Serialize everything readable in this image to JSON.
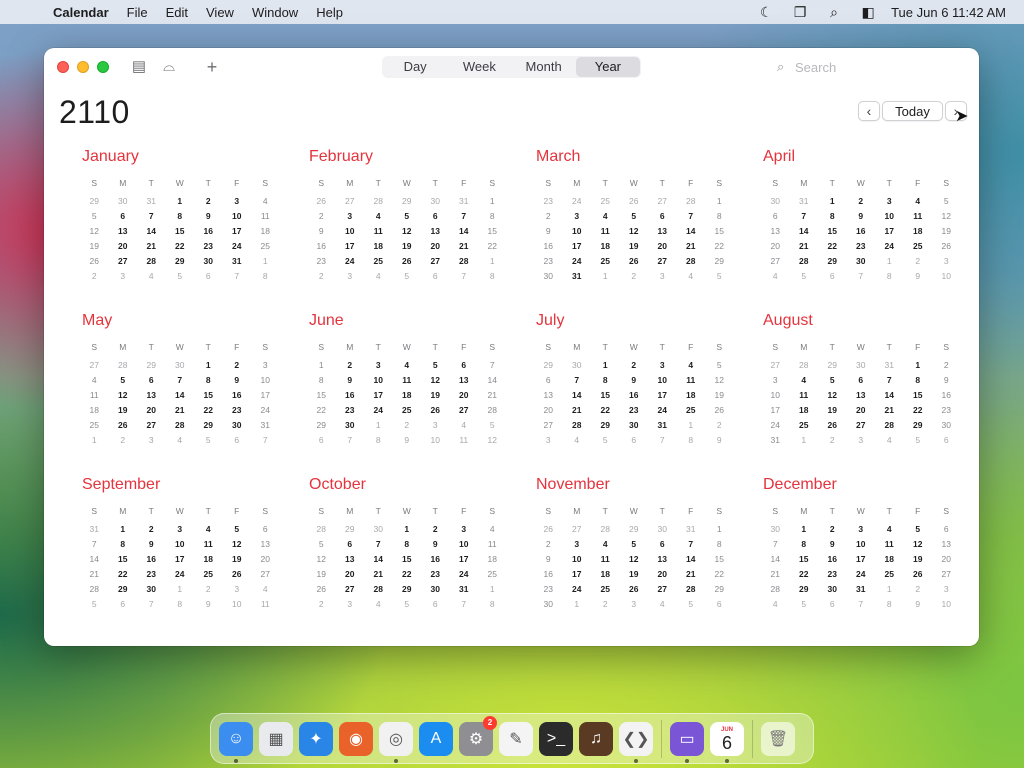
{
  "menubar": {
    "app_name": "Calendar",
    "menus": [
      "File",
      "Edit",
      "View",
      "Window",
      "Help"
    ],
    "clock": "Tue Jun 6  11:42 AM"
  },
  "toolbar": {
    "views": [
      "Day",
      "Week",
      "Month",
      "Year"
    ],
    "active_view": "Year",
    "search_placeholder": "Search",
    "today_label": "Today"
  },
  "year": "2110",
  "weekday_labels": [
    "S",
    "M",
    "T",
    "W",
    "T",
    "F",
    "S"
  ],
  "months": [
    {
      "name": "January",
      "weeks": [
        [
          "29",
          "30",
          "31",
          "1",
          "2",
          "3",
          "4"
        ],
        [
          "5",
          "6",
          "7",
          "8",
          "9",
          "10",
          "11"
        ],
        [
          "12",
          "13",
          "14",
          "15",
          "16",
          "17",
          "18"
        ],
        [
          "19",
          "20",
          "21",
          "22",
          "23",
          "24",
          "25"
        ],
        [
          "26",
          "27",
          "28",
          "29",
          "30",
          "31",
          "1"
        ],
        [
          "2",
          "3",
          "4",
          "5",
          "6",
          "7",
          "8"
        ]
      ],
      "lead": 3,
      "trail_from": 4
    },
    {
      "name": "February",
      "weeks": [
        [
          "26",
          "27",
          "28",
          "29",
          "30",
          "31",
          "1"
        ],
        [
          "2",
          "3",
          "4",
          "5",
          "6",
          "7",
          "8"
        ],
        [
          "9",
          "10",
          "11",
          "12",
          "13",
          "14",
          "15"
        ],
        [
          "16",
          "17",
          "18",
          "19",
          "20",
          "21",
          "22"
        ],
        [
          "23",
          "24",
          "25",
          "26",
          "27",
          "28",
          "1"
        ],
        [
          "2",
          "3",
          "4",
          "5",
          "6",
          "7",
          "8"
        ]
      ],
      "lead": 6,
      "trail_from": 4
    },
    {
      "name": "March",
      "weeks": [
        [
          "23",
          "24",
          "25",
          "26",
          "27",
          "28",
          "1"
        ],
        [
          "2",
          "3",
          "4",
          "5",
          "6",
          "7",
          "8"
        ],
        [
          "9",
          "10",
          "11",
          "12",
          "13",
          "14",
          "15"
        ],
        [
          "16",
          "17",
          "18",
          "19",
          "20",
          "21",
          "22"
        ],
        [
          "23",
          "24",
          "25",
          "26",
          "27",
          "28",
          "29"
        ],
        [
          "30",
          "31",
          "1",
          "2",
          "3",
          "4",
          "5"
        ]
      ],
      "lead": 6,
      "trail_from": 5
    },
    {
      "name": "April",
      "weeks": [
        [
          "30",
          "31",
          "1",
          "2",
          "3",
          "4",
          "5"
        ],
        [
          "6",
          "7",
          "8",
          "9",
          "10",
          "11",
          "12"
        ],
        [
          "13",
          "14",
          "15",
          "16",
          "17",
          "18",
          "19"
        ],
        [
          "20",
          "21",
          "22",
          "23",
          "24",
          "25",
          "26"
        ],
        [
          "27",
          "28",
          "29",
          "30",
          "1",
          "2",
          "3"
        ],
        [
          "4",
          "5",
          "6",
          "7",
          "8",
          "9",
          "10"
        ]
      ],
      "lead": 2,
      "trail_from": 4
    },
    {
      "name": "May",
      "weeks": [
        [
          "27",
          "28",
          "29",
          "30",
          "1",
          "2",
          "3"
        ],
        [
          "4",
          "5",
          "6",
          "7",
          "8",
          "9",
          "10"
        ],
        [
          "11",
          "12",
          "13",
          "14",
          "15",
          "16",
          "17"
        ],
        [
          "18",
          "19",
          "20",
          "21",
          "22",
          "23",
          "24"
        ],
        [
          "25",
          "26",
          "27",
          "28",
          "29",
          "30",
          "31"
        ],
        [
          "1",
          "2",
          "3",
          "4",
          "5",
          "6",
          "7"
        ]
      ],
      "lead": 4,
      "trail_from": 5
    },
    {
      "name": "June",
      "weeks": [
        [
          "1",
          "2",
          "3",
          "4",
          "5",
          "6",
          "7"
        ],
        [
          "8",
          "9",
          "10",
          "11",
          "12",
          "13",
          "14"
        ],
        [
          "15",
          "16",
          "17",
          "18",
          "19",
          "20",
          "21"
        ],
        [
          "22",
          "23",
          "24",
          "25",
          "26",
          "27",
          "28"
        ],
        [
          "29",
          "30",
          "1",
          "2",
          "3",
          "4",
          "5"
        ],
        [
          "6",
          "7",
          "8",
          "9",
          "10",
          "11",
          "12"
        ]
      ],
      "lead": 0,
      "trail_from": 4
    },
    {
      "name": "July",
      "weeks": [
        [
          "29",
          "30",
          "1",
          "2",
          "3",
          "4",
          "5"
        ],
        [
          "6",
          "7",
          "8",
          "9",
          "10",
          "11",
          "12"
        ],
        [
          "13",
          "14",
          "15",
          "16",
          "17",
          "18",
          "19"
        ],
        [
          "20",
          "21",
          "22",
          "23",
          "24",
          "25",
          "26"
        ],
        [
          "27",
          "28",
          "29",
          "30",
          "31",
          "1",
          "2"
        ],
        [
          "3",
          "4",
          "5",
          "6",
          "7",
          "8",
          "9"
        ]
      ],
      "lead": 2,
      "trail_from": 4
    },
    {
      "name": "August",
      "weeks": [
        [
          "27",
          "28",
          "29",
          "30",
          "31",
          "1",
          "2"
        ],
        [
          "3",
          "4",
          "5",
          "6",
          "7",
          "8",
          "9"
        ],
        [
          "10",
          "11",
          "12",
          "13",
          "14",
          "15",
          "16"
        ],
        [
          "17",
          "18",
          "19",
          "20",
          "21",
          "22",
          "23"
        ],
        [
          "24",
          "25",
          "26",
          "27",
          "28",
          "29",
          "30"
        ],
        [
          "31",
          "1",
          "2",
          "3",
          "4",
          "5",
          "6"
        ]
      ],
      "lead": 5,
      "trail_from": 5
    },
    {
      "name": "September",
      "weeks": [
        [
          "31",
          "1",
          "2",
          "3",
          "4",
          "5",
          "6"
        ],
        [
          "7",
          "8",
          "9",
          "10",
          "11",
          "12",
          "13"
        ],
        [
          "14",
          "15",
          "16",
          "17",
          "18",
          "19",
          "20"
        ],
        [
          "21",
          "22",
          "23",
          "24",
          "25",
          "26",
          "27"
        ],
        [
          "28",
          "29",
          "30",
          "1",
          "2",
          "3",
          "4"
        ],
        [
          "5",
          "6",
          "7",
          "8",
          "9",
          "10",
          "11"
        ]
      ],
      "lead": 1,
      "trail_from": 4
    },
    {
      "name": "October",
      "weeks": [
        [
          "28",
          "29",
          "30",
          "1",
          "2",
          "3",
          "4"
        ],
        [
          "5",
          "6",
          "7",
          "8",
          "9",
          "10",
          "11"
        ],
        [
          "12",
          "13",
          "14",
          "15",
          "16",
          "17",
          "18"
        ],
        [
          "19",
          "20",
          "21",
          "22",
          "23",
          "24",
          "25"
        ],
        [
          "26",
          "27",
          "28",
          "29",
          "30",
          "31",
          "1"
        ],
        [
          "2",
          "3",
          "4",
          "5",
          "6",
          "7",
          "8"
        ]
      ],
      "lead": 3,
      "trail_from": 4
    },
    {
      "name": "November",
      "weeks": [
        [
          "26",
          "27",
          "28",
          "29",
          "30",
          "31",
          "1"
        ],
        [
          "2",
          "3",
          "4",
          "5",
          "6",
          "7",
          "8"
        ],
        [
          "9",
          "10",
          "11",
          "12",
          "13",
          "14",
          "15"
        ],
        [
          "16",
          "17",
          "18",
          "19",
          "20",
          "21",
          "22"
        ],
        [
          "23",
          "24",
          "25",
          "26",
          "27",
          "28",
          "29"
        ],
        [
          "30",
          "1",
          "2",
          "3",
          "4",
          "5",
          "6"
        ]
      ],
      "lead": 6,
      "trail_from": 5
    },
    {
      "name": "December",
      "weeks": [
        [
          "30",
          "1",
          "2",
          "3",
          "4",
          "5",
          "6"
        ],
        [
          "7",
          "8",
          "9",
          "10",
          "11",
          "12",
          "13"
        ],
        [
          "14",
          "15",
          "16",
          "17",
          "18",
          "19",
          "20"
        ],
        [
          "21",
          "22",
          "23",
          "24",
          "25",
          "26",
          "27"
        ],
        [
          "28",
          "29",
          "30",
          "31",
          "1",
          "2",
          "3"
        ],
        [
          "4",
          "5",
          "6",
          "7",
          "8",
          "9",
          "10"
        ]
      ],
      "lead": 1,
      "trail_from": 4
    }
  ],
  "dock": {
    "apps": [
      {
        "name": "finder",
        "icon": "finder-icon",
        "color": "#3b8ef0",
        "glyph": "☺",
        "running": true
      },
      {
        "name": "launchpad",
        "icon": "launchpad-icon",
        "color": "#e9eaee",
        "glyph": "▦",
        "running": false
      },
      {
        "name": "safari",
        "icon": "safari-icon",
        "color": "#2a86e6",
        "glyph": "✦",
        "running": false
      },
      {
        "name": "firefox",
        "icon": "firefox-icon",
        "color": "#e8622a",
        "glyph": "◉",
        "running": false
      },
      {
        "name": "chrome",
        "icon": "chrome-icon",
        "color": "#f1f1f1",
        "glyph": "◎",
        "running": true
      },
      {
        "name": "app-store",
        "icon": "app-store-icon",
        "color": "#1c8df0",
        "glyph": "A",
        "running": false
      },
      {
        "name": "system-settings",
        "icon": "settings-icon",
        "color": "#8e8e93",
        "glyph": "⚙",
        "running": false,
        "badge": "2"
      },
      {
        "name": "textedit",
        "icon": "textedit-icon",
        "color": "#f4f4f4",
        "glyph": "✎",
        "running": false
      },
      {
        "name": "terminal",
        "icon": "terminal-icon",
        "color": "#2b2b2b",
        "glyph": ">_",
        "running": false
      },
      {
        "name": "garageband",
        "icon": "garageband-icon",
        "color": "#5a3a22",
        "glyph": "♫",
        "running": false
      },
      {
        "name": "vscode",
        "icon": "vscode-icon",
        "color": "#f3f3f3",
        "glyph": "❮❯",
        "running": true
      }
    ],
    "apps_after": [
      {
        "name": "simulator",
        "icon": "simulator-icon",
        "color": "#7a55d6",
        "glyph": "▭",
        "running": true
      },
      {
        "name": "calendar",
        "icon": "calendar-icon",
        "color": "#ffffff",
        "glyph": "",
        "running": true
      }
    ],
    "calendar_icon_month": "JUN",
    "calendar_icon_day": "6"
  }
}
